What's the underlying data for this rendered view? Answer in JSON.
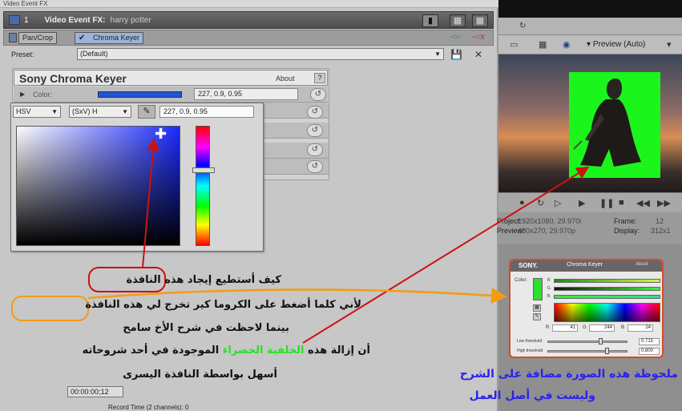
{
  "fx_window": {
    "title": "Video Event FX",
    "track_number": "1",
    "fx_label": "Video Event FX:",
    "fx_name": "harry potter",
    "chain": [
      "Pan/Crop",
      "Chroma Keyer"
    ],
    "preset_label": "Preset:",
    "preset_value": "(Default)"
  },
  "plugin": {
    "title": "Sony Chroma Keyer",
    "about": "About",
    "help": "?",
    "color_label": "Color:",
    "color_value": "227, 0.9, 0.95",
    "swatch_color": "#1f55d6"
  },
  "picker": {
    "mode": "HSV",
    "channel": "(SxV) H",
    "value": "227, 0.9, 0.95"
  },
  "preview": {
    "quality": "Preview (Auto)",
    "project_label": "Project:",
    "project_value": "1920x1080, 29.970i",
    "preview_label": "Preview:",
    "preview_value": "480x270, 29.970p",
    "frame_label": "Frame:",
    "frame_value": "12",
    "display_label": "Display:",
    "display_value": "312x1",
    "time": "00:00:00;12",
    "record_time": "Record Time (2 channels): 0"
  },
  "inset": {
    "brand": "SONY.",
    "title": "Chroma Keyer",
    "about": "About",
    "color_label": "Color:",
    "channels": [
      "R",
      "G",
      "B"
    ],
    "r_value": "41",
    "g_value": "244",
    "b_value": "24",
    "low_threshold_label": "Low threshold",
    "low_threshold_value": "0.715",
    "high_threshold_label": "High threshold",
    "high_threshold_value": "0.800"
  },
  "annotations": {
    "line1_prefix": "كيف أستطيع إيجاد ",
    "line1_circled": "هذه النافذة",
    "line2_prefix": "لأني كلما أضغط على الكروما كير تخرج لي ",
    "line2_circled": "هذه النافذة",
    "line3": "بينما لاحظت في شرح الأخ سامح",
    "line4_prefix": "أن إزالة هذه ",
    "line4_green": "الخلفية الخضراء",
    "line4_suffix": " الموجودة في أحد شروحاته",
    "line5": "أسهل بواسطة النافذة اليسرى",
    "note_line1": "ملحوظة هذه الصورة مضافة على الشرح",
    "note_line2": "وليست في أصل العمل"
  },
  "colors": {
    "annotation_circle": "#e67e22",
    "arrow_red": "#cc1111",
    "green_screen": "#1cf51c",
    "note_blue": "#2a22ee"
  }
}
